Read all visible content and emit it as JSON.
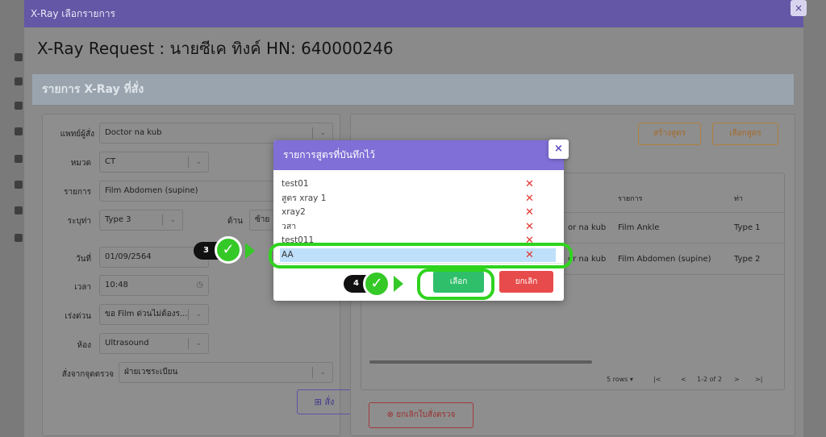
{
  "window": {
    "title": "X-Ray เลือกรายการ",
    "close_icon": "×",
    "header": "X-Ray Request : นายซีเค ทิงค์ HN: 640000246"
  },
  "section": {
    "title": "รายการ X-Ray ที่สั่ง"
  },
  "form": {
    "doctor": {
      "label": "แพทย์ผู้สั่ง",
      "value": "Doctor na kub"
    },
    "category": {
      "label": "หมวด",
      "value": "CT"
    },
    "item": {
      "label": "รายการ",
      "value": "Film Abdomen (supine)"
    },
    "pose": {
      "label": "ระบุท่า",
      "value": "Type 3"
    },
    "side": {
      "label": "ด้าน",
      "value": "ซ้าย"
    },
    "date": {
      "label": "วันที่",
      "value": "01/09/2564"
    },
    "time": {
      "label": "เวลา",
      "value": "10:48"
    },
    "urgency": {
      "label": "เร่งด่วน",
      "value": "ขอ Film ด่วนไม่ต้องร..."
    },
    "room": {
      "label": "ห้อง",
      "value": "Ultrasound"
    },
    "from_point": {
      "label": "สั่งจากจุดตรวจ",
      "value": "ฝ่ายเวชระเบียน"
    },
    "add_button": "สั่ง"
  },
  "right_panel": {
    "create_formula_button": "สร้างสูตร",
    "select_formula_button": "เลือกสูตร",
    "table": {
      "headers": [
        "รายการ",
        "ท่า"
      ],
      "rows": [
        {
          "doctor": "or na kub",
          "item": "Film Ankle",
          "pose": "Type 1"
        },
        {
          "doctor": "or na kub",
          "item": "Film Abdomen (supine)",
          "pose": "Type 2"
        }
      ],
      "pager": {
        "rows_label": "5 rows",
        "range": "1-2 of 2"
      }
    },
    "cancel_order_button": "ยกเลิกใบสั่งตรวจ"
  },
  "modal": {
    "title": "รายการสูตรที่บันทึกไว้",
    "items": [
      "test01",
      "สูตร xray 1",
      "xray2",
      "วสา",
      "test011",
      "AA"
    ],
    "selected_index": 5,
    "pick_button": "เลือก",
    "cancel_button": "ยกเลิก",
    "close_icon": "×"
  },
  "annotations": {
    "step3": "3",
    "step4": "4"
  },
  "colors": {
    "modal_header": "#7f6fd6",
    "pick_button": "#2fbf6a",
    "cancel_button": "#e84b4b",
    "highlight_ring": "#2fd31e",
    "selected_row": "#bfe0fb"
  }
}
